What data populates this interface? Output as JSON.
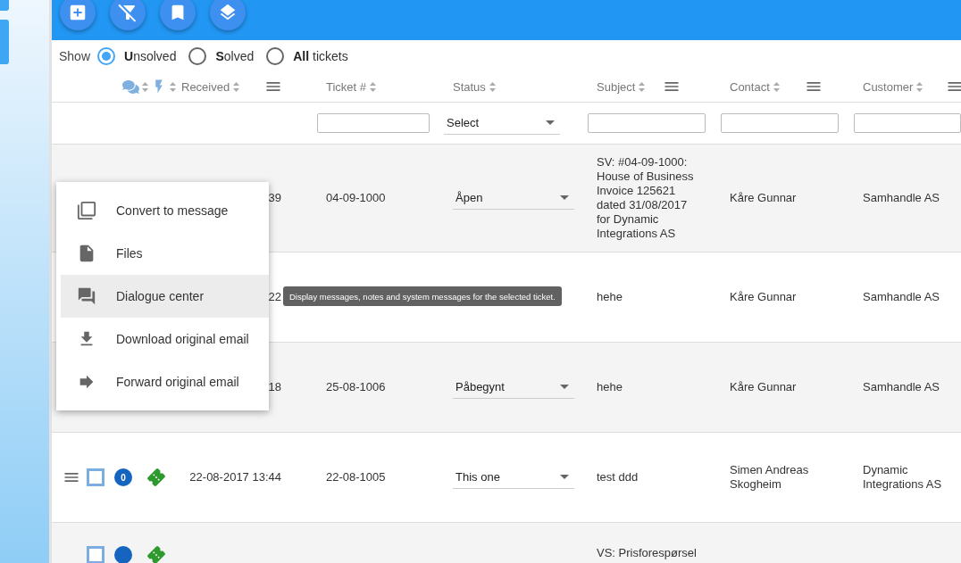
{
  "toolbar": {
    "buttons": [
      {
        "kind": "add"
      },
      {
        "kind": "filter"
      },
      {
        "kind": "bookmark"
      },
      {
        "kind": "layers"
      }
    ]
  },
  "show_filter": {
    "label": "Show",
    "options": [
      {
        "label": "**U**nsolved",
        "selected": true
      },
      {
        "label": "**S**olved",
        "selected": false
      },
      {
        "label": "**All** tickets",
        "selected": false
      }
    ]
  },
  "table": {
    "columns": [
      {
        "label": "Received"
      },
      {
        "label": "Ticket #"
      },
      {
        "label": "Status"
      },
      {
        "label": "Subject"
      },
      {
        "label": "Contact"
      },
      {
        "label": "Customer"
      }
    ],
    "status_filter": {
      "value": "Select"
    },
    "rows": [
      {
        "received": "39",
        "ticket": "04-09-1000",
        "status": "Åpen",
        "subject": "SV: #04-09-1000: House of Business Invoice 125621 dated 31/08/2017 for Dynamic Integrations AS",
        "contact": "Kåre Gunnar",
        "customer": "Samhandle AS"
      },
      {
        "received": "22",
        "subject": "hehe",
        "contact": "Kåre Gunnar",
        "customer": "Samhandle AS"
      },
      {
        "received": "18",
        "ticket": "25-08-1006",
        "status": "Påbegynt",
        "subject": "hehe",
        "contact": "Kåre Gunnar",
        "customer": "Samhandle AS"
      },
      {
        "checked": false,
        "badge": "0",
        "received": "22-08-2017 13:44",
        "ticket": "22-08-1005",
        "status": "This one",
        "subject": "test ddd",
        "contact": "Simen Andreas Skogheim",
        "customer": "Dynamic Integrations AS"
      },
      {
        "checked": false,
        "subject": "VS: Prisforespørsel"
      }
    ]
  },
  "context_menu": {
    "items": [
      {
        "label": "Convert to message",
        "selected": false
      },
      {
        "label": "Files",
        "selected": false
      },
      {
        "label": "Dialogue center",
        "selected": true
      },
      {
        "label": "Download original email",
        "selected": false
      },
      {
        "label": "Forward original email",
        "selected": false
      }
    ]
  },
  "tooltip": {
    "text": "Display messages, notes and system messages for the selected ticket."
  }
}
